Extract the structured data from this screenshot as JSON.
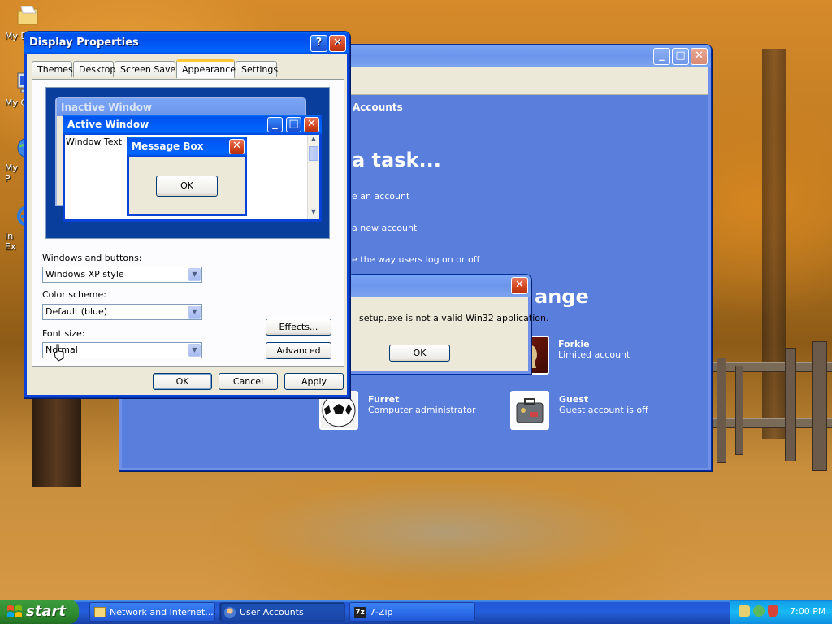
{
  "desktop": {
    "icons": [
      {
        "label": "My D"
      },
      {
        "label": "My C"
      },
      {
        "label": "My\nP"
      },
      {
        "label": "In\nEx"
      }
    ]
  },
  "user_accounts": {
    "partial_header": "Accounts",
    "task_heading": "a task...",
    "tasks": [
      "e an account",
      "a new account",
      "e the way users log on or off"
    ],
    "change_heading": "ange",
    "accounts": [
      {
        "name": "Forkie",
        "type": "Limited account"
      },
      {
        "name": "Furret",
        "type": "Computer administrator"
      },
      {
        "name": "Guest",
        "type": "Guest account is off"
      }
    ]
  },
  "error_dialog": {
    "message": "setup.exe is not a valid Win32 application.",
    "ok": "OK"
  },
  "display_properties": {
    "title": "Display Properties",
    "help_button": "?",
    "tabs": [
      "Themes",
      "Desktop",
      "Screen Saver",
      "Appearance",
      "Settings"
    ],
    "active_tab": "Appearance",
    "preview": {
      "inactive_title": "Inactive Window",
      "active_title": "Active Window",
      "window_text": "Window Text",
      "msgbox_title": "Message Box",
      "msgbox_ok": "OK"
    },
    "windows_buttons_label": "Windows and buttons:",
    "windows_buttons_value": "Windows XP style",
    "color_scheme_label": "Color scheme:",
    "color_scheme_value": "Default (blue)",
    "font_size_label": "Font size:",
    "font_size_value": "Normal",
    "effects": "Effects...",
    "advanced": "Advanced",
    "ok": "OK",
    "cancel": "Cancel",
    "apply": "Apply"
  },
  "taskbar": {
    "start": "start",
    "tasks": [
      "Network and Internet...",
      "User Accounts",
      "7-Zip"
    ],
    "clock": "7:00 PM"
  }
}
